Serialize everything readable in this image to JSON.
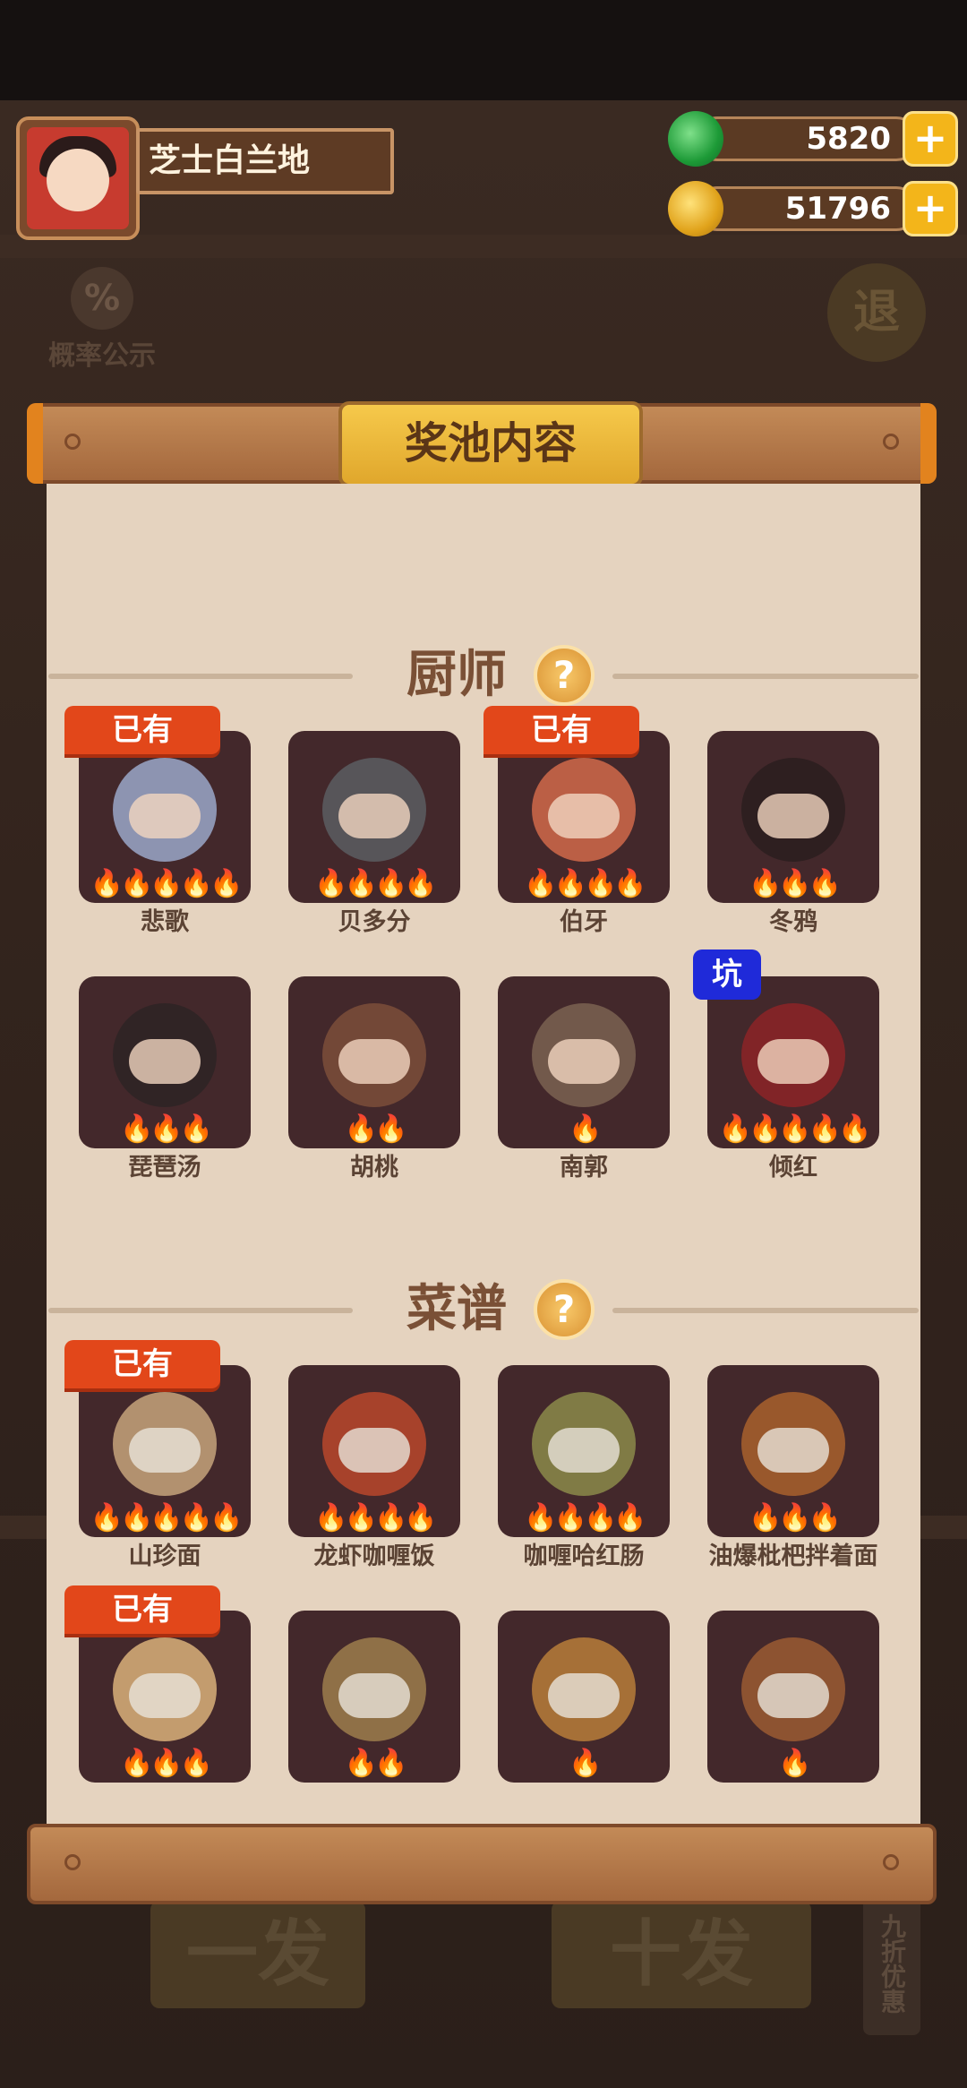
{
  "player": {
    "name": "芝士白兰地"
  },
  "currency": {
    "jade": "5820",
    "coins": "51796"
  },
  "background": {
    "probability_label": "概率公示",
    "exit_label": "退",
    "single_draw": "一发",
    "ten_draw": "十发",
    "discount": "九折优惠"
  },
  "panel": {
    "title": "奖池内容"
  },
  "chefs": {
    "section_label": "厨师",
    "items": [
      {
        "name": "悲歌",
        "flames": "🔥🔥🔥🔥🔥",
        "owned": true,
        "art": "#9aa7c9"
      },
      {
        "name": "贝多分",
        "flames": "🔥🔥🔥🔥",
        "owned": false,
        "art": "#5b5d62"
      },
      {
        "name": "伯牙",
        "flames": "🔥🔥🔥🔥",
        "owned": true,
        "art": "#d0684a"
      },
      {
        "name": "冬鸦",
        "flames": "🔥🔥🔥",
        "owned": false,
        "art": "#2a1d1f"
      },
      {
        "name": "琵琶汤",
        "flames": "🔥🔥🔥",
        "owned": false,
        "art": "#2d2325"
      },
      {
        "name": "胡桃",
        "flames": "🔥🔥",
        "owned": false,
        "art": "#7b4e3a"
      },
      {
        "name": "南郭",
        "flames": "🔥",
        "owned": false,
        "art": "#7a6151"
      },
      {
        "name": "倾红",
        "flames": "🔥🔥🔥🔥🔥",
        "owned": false,
        "pit": "坑",
        "art": "#8c2327"
      }
    ]
  },
  "recipes": {
    "section_label": "菜谱",
    "items": [
      {
        "name": "山珍面",
        "flames": "🔥🔥🔥🔥🔥",
        "owned": true,
        "art": "#c5a37b"
      },
      {
        "name": "龙虾咖喱饭",
        "flames": "🔥🔥🔥🔥",
        "owned": false,
        "art": "#b9462b"
      },
      {
        "name": "咖喱哈红肠",
        "flames": "🔥🔥🔥🔥",
        "owned": false,
        "art": "#8b8a4a"
      },
      {
        "name": "油爆枇杷拌着面",
        "flames": "🔥🔥🔥",
        "owned": false,
        "art": "#a8602d"
      },
      {
        "name": "",
        "flames": "🔥🔥🔥",
        "owned": true,
        "art": "#d9b07a"
      },
      {
        "name": "",
        "flames": "🔥🔥",
        "owned": false,
        "art": "#9c7c4c"
      },
      {
        "name": "",
        "flames": "🔥",
        "owned": false,
        "art": "#b77d3a"
      },
      {
        "name": "",
        "flames": "🔥",
        "owned": false,
        "art": "#9a5a32"
      }
    ]
  },
  "owned_label": "已有"
}
